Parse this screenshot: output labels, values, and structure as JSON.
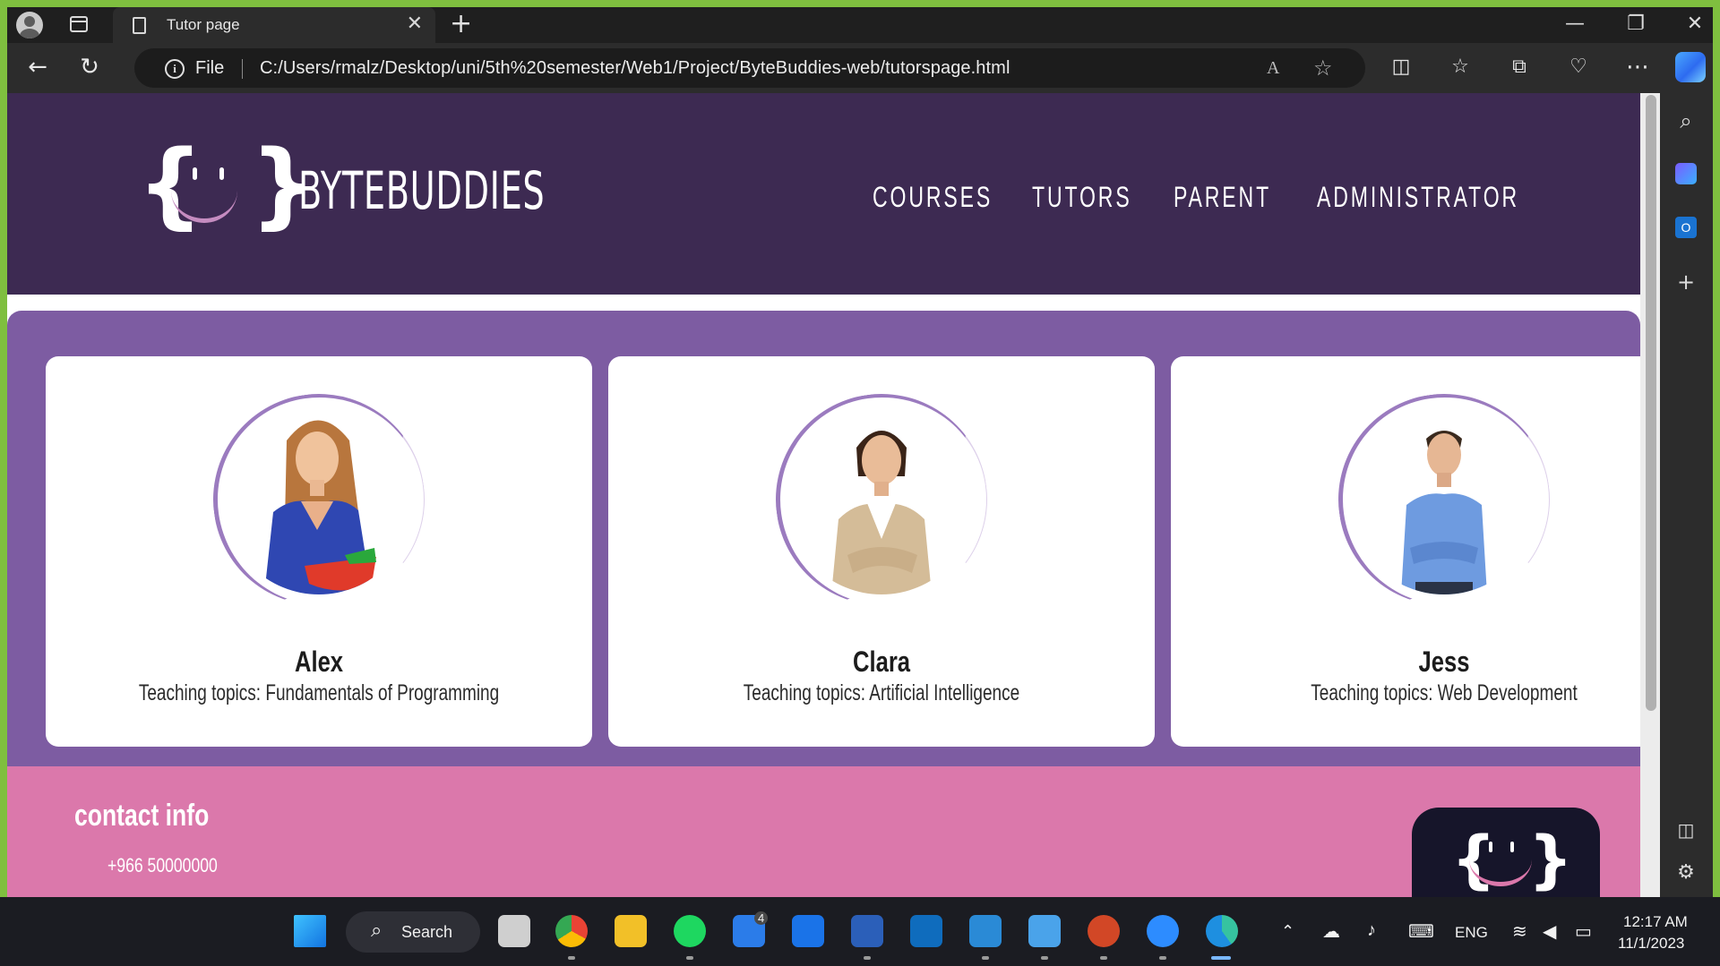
{
  "browser": {
    "tab_title": "Tutor page",
    "tab_close": "✕",
    "new_tab": "+",
    "address_scheme": "File",
    "url": "C:/Users/rmalz/Desktop/uni/5th%20semester/Web1/Project/ByteBuddies-web/tutorspage.html",
    "minimize": "—",
    "maximize": "❐",
    "close": "✕"
  },
  "site": {
    "logo_text": "BYTEBUDDIES",
    "logo_brace_open": "{",
    "logo_brace_close": "}",
    "nav": [
      "COURSES",
      "TUTORS",
      "PARENT",
      "ADMINISTRATOR"
    ],
    "tutors": [
      {
        "name": "Alex",
        "topic": "Teaching topics: Fundamentals of Programming"
      },
      {
        "name": "Clara",
        "topic": "Teaching topics: Artificial Intelligence"
      },
      {
        "name": "Jess",
        "topic": "Teaching topics: Web Development"
      }
    ],
    "contact": {
      "title": "contact info",
      "phone": "+966 50000000"
    }
  },
  "taskbar": {
    "search_label": "Search",
    "badge_count": "4",
    "language": "ENG",
    "time": "12:17 AM",
    "date": "11/1/2023"
  },
  "colors": {
    "header_bg": "#3d2a52",
    "section_bg": "#7d5ca2",
    "contact_bg": "#db78ab",
    "accent_ring": "#9b7bbf"
  },
  "icons": {
    "back": "arrow-left-icon",
    "refresh": "refresh-icon",
    "info": "info-icon",
    "read_aloud": "read-aloud-icon",
    "favorite": "star-icon"
  }
}
